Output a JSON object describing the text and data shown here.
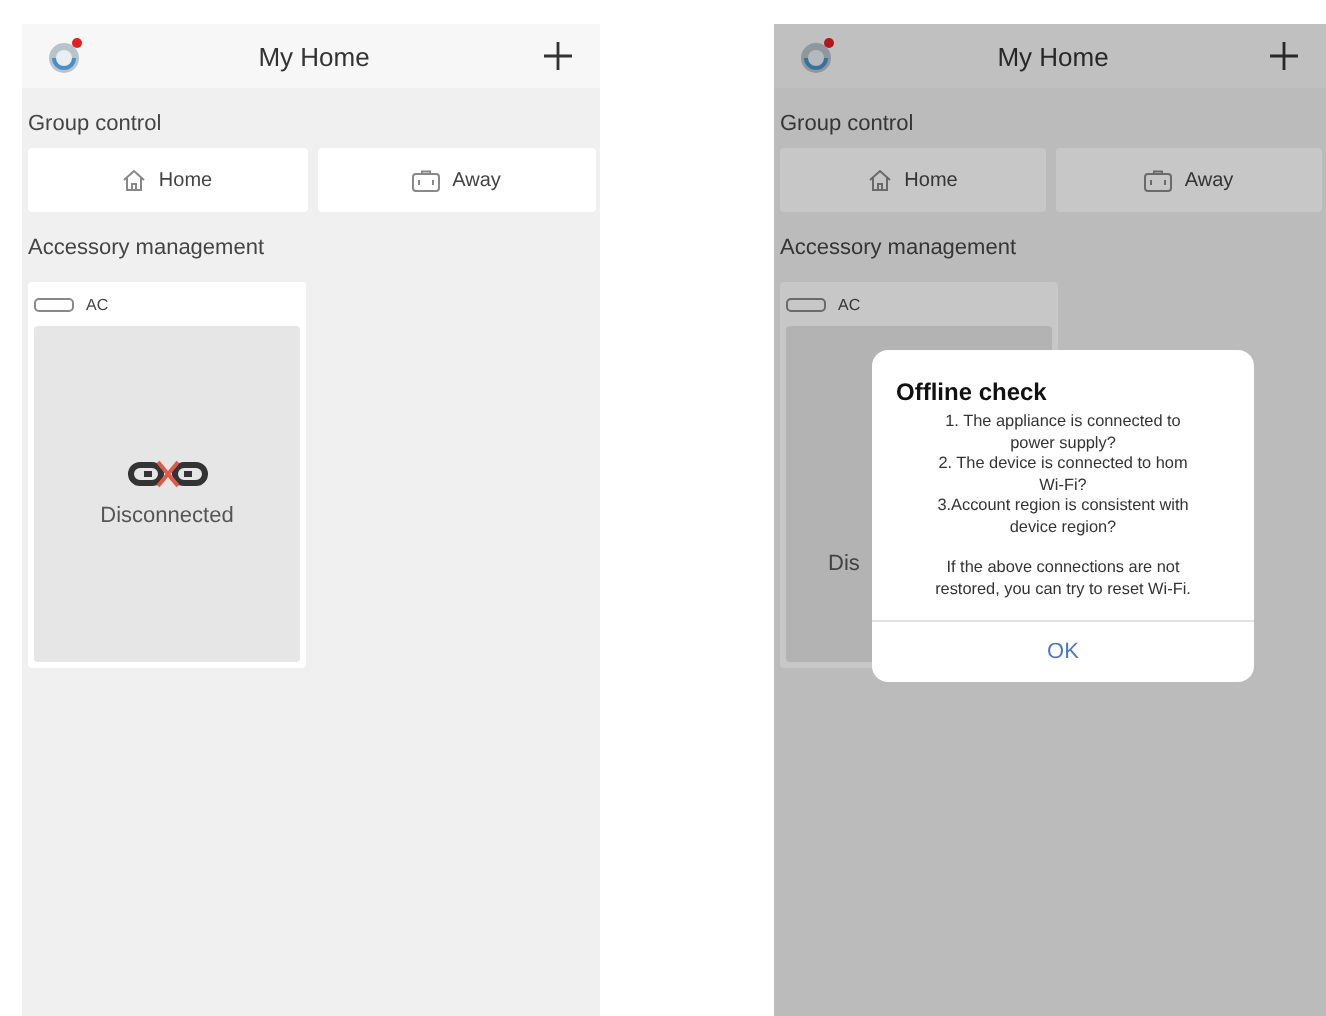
{
  "screens": [
    {
      "title": "My Home",
      "notification": true,
      "group_label": "Group control",
      "group_buttons": [
        {
          "kind": "home",
          "label": "Home"
        },
        {
          "kind": "away",
          "label": "Away"
        }
      ],
      "accessory_label": "Accessory management",
      "devices": [
        {
          "name": "AC",
          "status": "Disconnected"
        }
      ]
    },
    {
      "title": "My Home",
      "notification": true,
      "group_label": "Group control",
      "group_buttons": [
        {
          "kind": "home",
          "label": "Home"
        },
        {
          "kind": "away",
          "label": "Away"
        }
      ],
      "accessory_label": "Accessory management",
      "devices": [
        {
          "name": "AC",
          "status": "Dis"
        }
      ],
      "dialog": {
        "title": "Offline check",
        "paragraphs": [
          [
            "1. The appliance is connected to",
            "power supply?",
            "2. The device is connected to hom",
            "Wi-Fi?",
            "3.Account region is consistent with",
            "device region?"
          ],
          [
            "If the above connections are not",
            "restored, you can try to reset Wi-Fi."
          ]
        ],
        "button": "OK"
      }
    }
  ]
}
